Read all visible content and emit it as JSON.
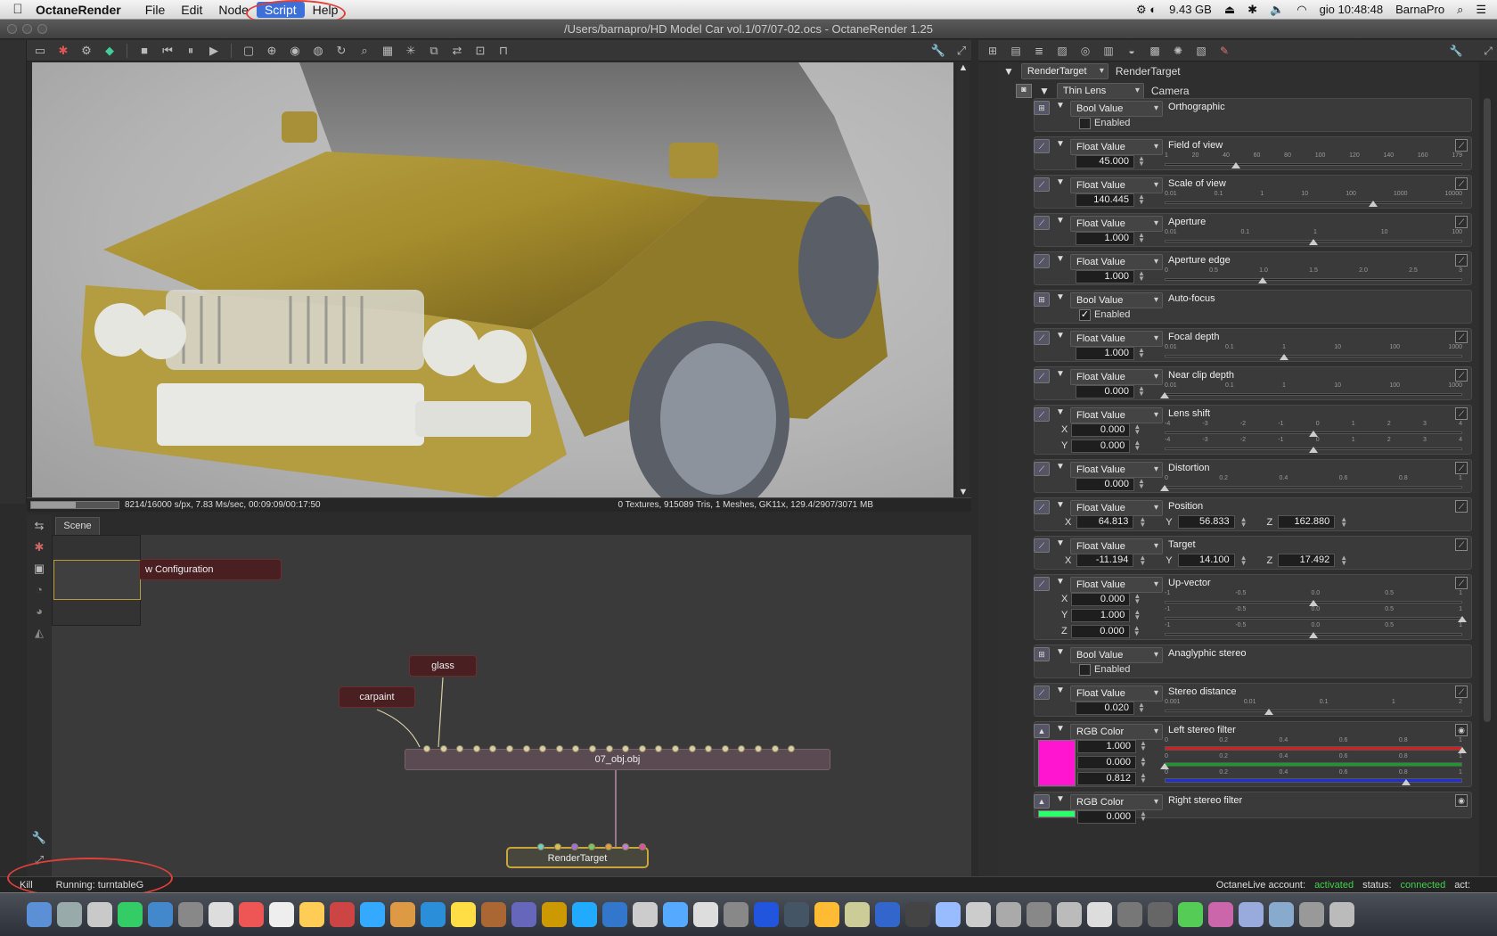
{
  "menubar": {
    "app_name": "OctaneRender",
    "items": [
      "File",
      "Edit",
      "Node",
      "Script",
      "Help"
    ],
    "selected": "Script",
    "memory": "9.43 GB",
    "clock": "gio 10:48:48",
    "user": "BarnaPro"
  },
  "window": {
    "title": "/Users/barnapro/HD Model Car vol.1/07/07-02.ocs - OctaneRender 1.25"
  },
  "viewport": {
    "status_left": "8214/16000 s/px, 7.83 Ms/sec, 00:09:09/00:17:50",
    "status_right": "0 Textures, 915089 Tris, 1 Meshes, GK11x, 129.4/2907/3071 MB",
    "progress_fraction": 0.51
  },
  "graph": {
    "tab": "Scene",
    "nodes": {
      "config": "w Configuration",
      "glass": "glass",
      "carpaint": "carpaint",
      "mesh": "07_obj.obj",
      "render_target": "RenderTarget"
    }
  },
  "bottombar": {
    "kill": "Kill",
    "running": "Running: turntableG",
    "account_label": "OctaneLive account:",
    "account_value": "activated",
    "status_label": "status:",
    "status_value": "connected",
    "act_label": "act:"
  },
  "inspector": {
    "root_type": "RenderTarget",
    "root_name": "RenderTarget",
    "camera_type": "Thin Lens Camera",
    "camera_name": "Camera",
    "enabled_label": "Enabled",
    "params": [
      {
        "type": "Bool Value",
        "name": "Orthographic",
        "checked": false
      },
      {
        "type": "Float Value",
        "name": "Field of view",
        "value": "45.000",
        "ticks": [
          "1",
          "20",
          "40",
          "60",
          "80",
          "100",
          "120",
          "140",
          "160",
          "179"
        ],
        "knob": 0.24
      },
      {
        "type": "Float Value",
        "name": "Scale of view",
        "value": "140.445",
        "ticks": [
          "0.01",
          "0.1",
          "1",
          "10",
          "100",
          "1000",
          "10000"
        ],
        "knob": 0.7
      },
      {
        "type": "Float Value",
        "name": "Aperture",
        "value": "1.000",
        "ticks": [
          "0.01",
          "0.1",
          "1",
          "10",
          "100"
        ],
        "knob": 0.5
      },
      {
        "type": "Float Value",
        "name": "Aperture edge",
        "value": "1.000",
        "ticks": [
          "0",
          "0.5",
          "1.0",
          "1.5",
          "2.0",
          "2.5",
          "3"
        ],
        "knob": 0.33
      },
      {
        "type": "Bool Value",
        "name": "Auto-focus",
        "checked": true
      },
      {
        "type": "Float Value",
        "name": "Focal depth",
        "value": "1.000",
        "ticks": [
          "0.01",
          "0.1",
          "1",
          "10",
          "100",
          "1000"
        ],
        "knob": 0.4
      },
      {
        "type": "Float Value",
        "name": "Near clip depth",
        "value": "0.000",
        "ticks": [
          "0.01",
          "0.1",
          "1",
          "10",
          "100",
          "1000"
        ],
        "knob": 0.0
      },
      {
        "type": "Float Value",
        "name": "Lens shift",
        "x": "0.000",
        "y": "0.000",
        "ticks": [
          "-4",
          "-3",
          "-2",
          "-1",
          "0",
          "1",
          "2",
          "3",
          "4"
        ],
        "knob": 0.5
      },
      {
        "type": "Float Value",
        "name": "Distortion",
        "value": "0.000",
        "ticks": [
          "0",
          "0.2",
          "0.4",
          "0.6",
          "0.8",
          "1"
        ],
        "knob": 0.0
      },
      {
        "type": "Float Value",
        "name": "Position",
        "x": "64.813",
        "y": "56.833",
        "z": "162.880"
      },
      {
        "type": "Float Value",
        "name": "Target",
        "x": "-11.194",
        "y": "14.100",
        "z": "17.492"
      },
      {
        "type": "Float Value",
        "name": "Up-vector",
        "x": "0.000",
        "y": "1.000",
        "z": "0.000",
        "ticks": [
          "-1",
          "-0.5",
          "0.0",
          "0.5",
          "1"
        ],
        "knobs": [
          0.5,
          1.0,
          0.5
        ]
      },
      {
        "type": "Bool Value",
        "name": "Anaglyphic stereo",
        "checked": false
      },
      {
        "type": "Float Value",
        "name": "Stereo distance",
        "value": "0.020",
        "ticks": [
          "0.001",
          "0.01",
          "0.1",
          "1",
          "2"
        ],
        "knob": 0.35
      },
      {
        "type": "RGB Color",
        "name": "Left stereo filter",
        "r": "1.000",
        "g": "0.000",
        "b": "0.812",
        "swatch": "#ff14d0",
        "ticks": [
          "0",
          "0.2",
          "0.4",
          "0.6",
          "0.8",
          "1"
        ]
      },
      {
        "type": "RGB Color",
        "name": "Right stereo filter",
        "r": "0.000",
        "swatch": "#2bff6a"
      }
    ]
  }
}
